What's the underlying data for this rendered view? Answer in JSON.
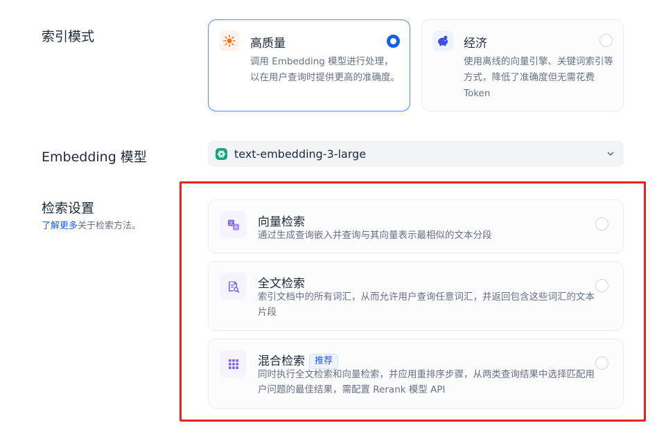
{
  "index_mode": {
    "label": "索引模式",
    "options": [
      {
        "title": "高质量",
        "description": "调用 Embedding 模型进行处理，以在用户查询时提供更高的准确度。",
        "icon": "sun-icon",
        "selected": true
      },
      {
        "title": "经济",
        "description": "使用离线的向量引擎、关键词索引等方式，降低了准确度但无需花费 Token",
        "icon": "piggy-bank-icon",
        "selected": false
      }
    ]
  },
  "embedding": {
    "label": "Embedding 模型",
    "selected_model": "text-embedding-3-large",
    "provider_icon": "openai-icon"
  },
  "retrieval": {
    "label": "检索设置",
    "help_link": "了解更多",
    "help_suffix": "关于检索方法。",
    "options": [
      {
        "title": "向量检索",
        "description": "通过生成查询嵌入并查询与其向量表示最相似的文本分段",
        "icon": "translate-icon",
        "selected": false
      },
      {
        "title": "全文检索",
        "description": "索引文档中的所有词汇，从而允许用户查询任意词汇，并返回包含这些词汇的文本片段",
        "icon": "file-search-icon",
        "selected": false
      },
      {
        "title": "混合检索",
        "badge": "推荐",
        "description": "同时执行全文检索和向量检索，并应用重排序步骤，从两类查询结果中选择匹配用户问题的最佳结果，需配置 Rerank 模型 API",
        "icon": "grid-icon",
        "selected": false
      }
    ]
  },
  "colors": {
    "accent": "#155eef",
    "highlight": "#e8231b",
    "icon_bg": "#f5f3ff"
  }
}
